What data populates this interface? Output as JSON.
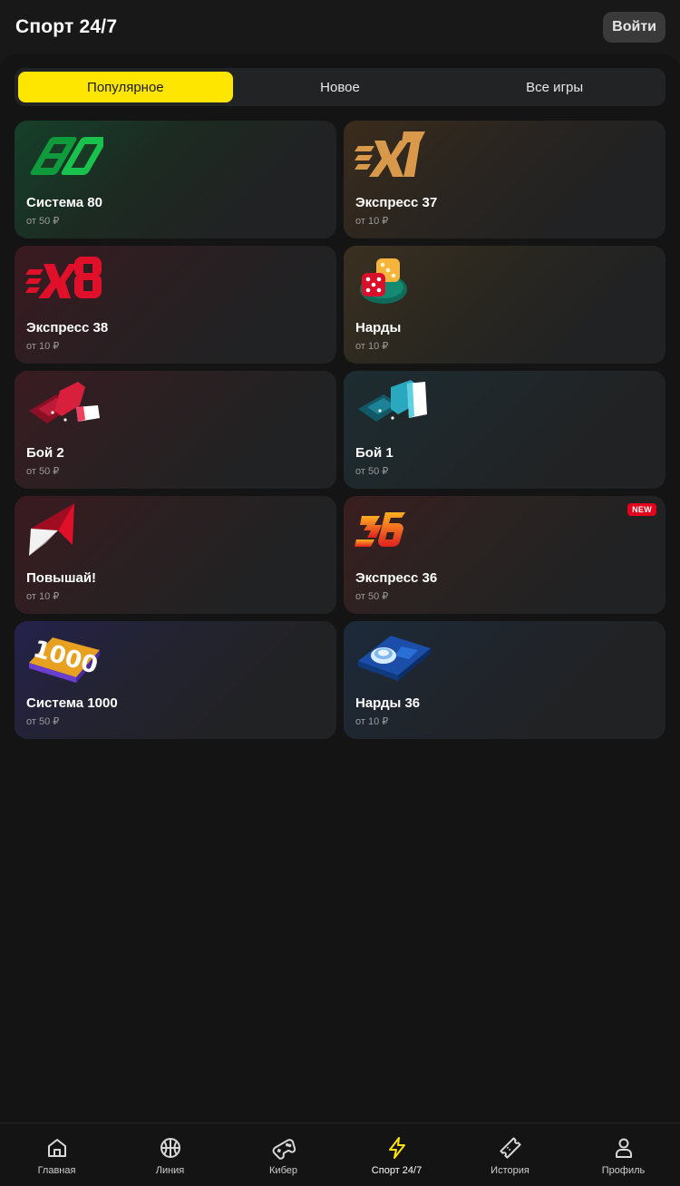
{
  "header": {
    "title": "Спорт 24/7",
    "login_label": "Войти"
  },
  "tabs": [
    {
      "label": "Популярное",
      "active": true
    },
    {
      "label": "Новое",
      "active": false
    },
    {
      "label": "Все игры",
      "active": false
    }
  ],
  "games": [
    {
      "name": "Система 80",
      "price": "от 50 ₽",
      "icon": "sistema-80-logo-icon",
      "accent": "#1fa34a"
    },
    {
      "name": "Экспресс 37",
      "price": "от 10 ₽",
      "icon": "express-37-logo-icon",
      "accent": "#c8863a"
    },
    {
      "name": "Экспресс 38",
      "price": "от 10 ₽",
      "icon": "express-38-logo-icon",
      "accent": "#d8102a"
    },
    {
      "name": "Нарды",
      "price": "от 10 ₽",
      "icon": "dice-icon",
      "accent": "#e8a020"
    },
    {
      "name": "Бой 2",
      "price": "от 50 ₽",
      "icon": "boi-2-logo-icon",
      "accent": "#b81c38"
    },
    {
      "name": "Бой 1",
      "price": "от 50 ₽",
      "icon": "boi-1-logo-icon",
      "accent": "#2a9bb0"
    },
    {
      "name": "Повышай!",
      "price": "от 10 ₽",
      "icon": "arrow-up-logo-icon",
      "accent": "#e0102a"
    },
    {
      "name": "Экспресс 36",
      "price": "от 50 ₽",
      "icon": "express-36-logo-icon",
      "accent": "#f08020",
      "badge": "NEW"
    },
    {
      "name": "Система 1000",
      "price": "от 50 ₽",
      "icon": "sistema-1000-logo-icon",
      "accent": "#6a3fd0"
    },
    {
      "name": "Нарды 36",
      "price": "от 10 ₽",
      "icon": "nardy-36-logo-icon",
      "accent": "#2a6fd8"
    }
  ],
  "nav": [
    {
      "label": "Главная",
      "icon": "home-icon",
      "active": false
    },
    {
      "label": "Линия",
      "icon": "basketball-icon",
      "active": false
    },
    {
      "label": "Кибер",
      "icon": "gamepad-icon",
      "active": false
    },
    {
      "label": "Спорт 24/7",
      "icon": "lightning-icon",
      "active": true
    },
    {
      "label": "История",
      "icon": "ticket-icon",
      "active": false
    },
    {
      "label": "Профиль",
      "icon": "user-icon",
      "active": false
    }
  ],
  "colors": {
    "accent_yellow": "#ffe600",
    "background": "#181818",
    "card": "#212223",
    "badge_red": "#e3001b"
  }
}
